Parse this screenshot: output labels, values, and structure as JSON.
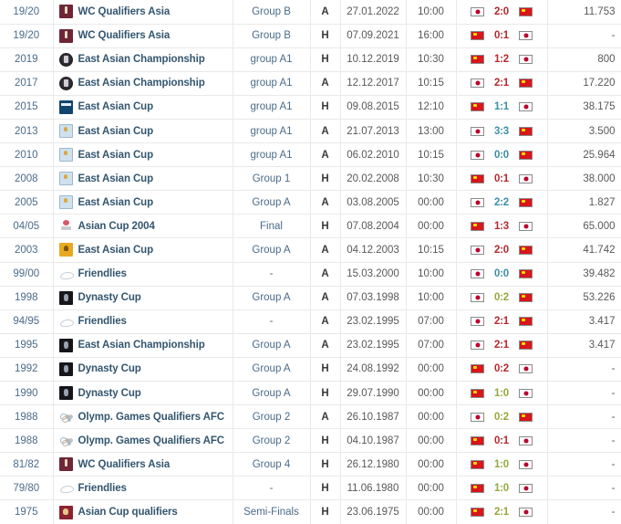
{
  "table": {
    "name": "match-history-table",
    "colors": {
      "link": "#33566f",
      "season": "#4a6b8a",
      "score_loss": "#b4292f",
      "score_win": "#93a93d",
      "score_draw": "#3a8fa3",
      "row_border": "#e9e9ea"
    },
    "rows": [
      {
        "season": "19/20",
        "logo": "wc-qualifiers-asia-logo",
        "competition": "WC Qualifiers Asia",
        "round": "Group B",
        "venue": "A",
        "date": "27.01.2022",
        "time": "10:00",
        "home_flag": "japan-flag",
        "score": "2:0",
        "score_type": "loss",
        "away_flag": "china-flag",
        "attendance": "11.753"
      },
      {
        "season": "19/20",
        "logo": "wc-qualifiers-asia-logo",
        "competition": "WC Qualifiers Asia",
        "round": "Group B",
        "venue": "H",
        "date": "07.09.2021",
        "time": "16:00",
        "home_flag": "china-flag",
        "score": "0:1",
        "score_type": "loss",
        "away_flag": "japan-flag",
        "attendance": "-"
      },
      {
        "season": "2019",
        "logo": "east-asian-championship-logo",
        "competition": "East Asian Championship",
        "round": "group A1",
        "venue": "H",
        "date": "10.12.2019",
        "time": "10:30",
        "home_flag": "china-flag",
        "score": "1:2",
        "score_type": "loss",
        "away_flag": "japan-flag",
        "attendance": "800"
      },
      {
        "season": "2017",
        "logo": "east-asian-championship-logo",
        "competition": "East Asian Championship",
        "round": "group A1",
        "venue": "A",
        "date": "12.12.2017",
        "time": "10:15",
        "home_flag": "japan-flag",
        "score": "2:1",
        "score_type": "loss",
        "away_flag": "china-flag",
        "attendance": "17.220"
      },
      {
        "season": "2015",
        "logo": "east-asian-cup-blue-logo",
        "competition": "East Asian Cup",
        "round": "group A1",
        "venue": "H",
        "date": "09.08.2015",
        "time": "12:10",
        "home_flag": "china-flag",
        "score": "1:1",
        "score_type": "draw",
        "away_flag": "japan-flag",
        "attendance": "38.175"
      },
      {
        "season": "2013",
        "logo": "east-asian-cup-lightblue-logo",
        "competition": "East Asian Cup",
        "round": "group A1",
        "venue": "A",
        "date": "21.07.2013",
        "time": "13:00",
        "home_flag": "japan-flag",
        "score": "3:3",
        "score_type": "draw",
        "away_flag": "china-flag",
        "attendance": "3.500"
      },
      {
        "season": "2010",
        "logo": "east-asian-cup-lightblue-logo",
        "competition": "East Asian Cup",
        "round": "group A1",
        "venue": "A",
        "date": "06.02.2010",
        "time": "10:15",
        "home_flag": "japan-flag",
        "score": "0:0",
        "score_type": "draw",
        "away_flag": "china-flag",
        "attendance": "25.964"
      },
      {
        "season": "2008",
        "logo": "east-asian-cup-lightblue-logo",
        "competition": "East Asian Cup",
        "round": "Group 1",
        "venue": "H",
        "date": "20.02.2008",
        "time": "10:30",
        "home_flag": "china-flag",
        "score": "0:1",
        "score_type": "loss",
        "away_flag": "japan-flag",
        "attendance": "38.000"
      },
      {
        "season": "2005",
        "logo": "east-asian-cup-lightblue-logo",
        "competition": "East Asian Cup",
        "round": "Group A",
        "venue": "A",
        "date": "03.08.2005",
        "time": "00:00",
        "home_flag": "japan-flag",
        "score": "2:2",
        "score_type": "draw",
        "away_flag": "china-flag",
        "attendance": "1.827"
      },
      {
        "season": "04/05",
        "logo": "asian-cup-2004-logo",
        "competition": "Asian Cup 2004",
        "round": "Final",
        "venue": "H",
        "date": "07.08.2004",
        "time": "00:00",
        "home_flag": "china-flag",
        "score": "1:3",
        "score_type": "loss",
        "away_flag": "japan-flag",
        "attendance": "65.000"
      },
      {
        "season": "2003",
        "logo": "east-asian-cup-gold-logo",
        "competition": "East Asian Cup",
        "round": "Group A",
        "venue": "A",
        "date": "04.12.2003",
        "time": "10:15",
        "home_flag": "japan-flag",
        "score": "2:0",
        "score_type": "loss",
        "away_flag": "china-flag",
        "attendance": "41.742"
      },
      {
        "season": "99/00",
        "logo": "friendlies-logo",
        "competition": "Friendlies",
        "round": "-",
        "venue": "A",
        "date": "15.03.2000",
        "time": "10:00",
        "home_flag": "japan-flag",
        "score": "0:0",
        "score_type": "draw",
        "away_flag": "china-flag",
        "attendance": "39.482"
      },
      {
        "season": "1998",
        "logo": "dynasty-cup-logo",
        "competition": "Dynasty Cup",
        "round": "Group A",
        "venue": "A",
        "date": "07.03.1998",
        "time": "10:00",
        "home_flag": "japan-flag",
        "score": "0:2",
        "score_type": "win",
        "away_flag": "china-flag",
        "attendance": "53.226"
      },
      {
        "season": "94/95",
        "logo": "friendlies-logo",
        "competition": "Friendlies",
        "round": "-",
        "venue": "A",
        "date": "23.02.1995",
        "time": "07:00",
        "home_flag": "japan-flag",
        "score": "2:1",
        "score_type": "loss",
        "away_flag": "china-flag",
        "attendance": "3.417"
      },
      {
        "season": "1995",
        "logo": "dynasty-cup-logo",
        "competition": "East Asian Championship",
        "round": "Group A",
        "venue": "A",
        "date": "23.02.1995",
        "time": "07:00",
        "home_flag": "japan-flag",
        "score": "2:1",
        "score_type": "loss",
        "away_flag": "china-flag",
        "attendance": "3.417"
      },
      {
        "season": "1992",
        "logo": "dynasty-cup-logo",
        "competition": "Dynasty Cup",
        "round": "Group A",
        "venue": "H",
        "date": "24.08.1992",
        "time": "00:00",
        "home_flag": "china-flag",
        "score": "0:2",
        "score_type": "loss",
        "away_flag": "japan-flag",
        "attendance": "-"
      },
      {
        "season": "1990",
        "logo": "dynasty-cup-logo",
        "competition": "Dynasty Cup",
        "round": "Group A",
        "venue": "H",
        "date": "29.07.1990",
        "time": "00:00",
        "home_flag": "china-flag",
        "score": "1:0",
        "score_type": "win",
        "away_flag": "japan-flag",
        "attendance": "-"
      },
      {
        "season": "1988",
        "logo": "olympic-games-qualifiers-logo",
        "competition": "Olymp. Games Qualifiers AFC",
        "round": "Group 2",
        "venue": "A",
        "date": "26.10.1987",
        "time": "00:00",
        "home_flag": "japan-flag",
        "score": "0:2",
        "score_type": "win",
        "away_flag": "china-flag",
        "attendance": "-"
      },
      {
        "season": "1988",
        "logo": "olympic-games-qualifiers-logo",
        "competition": "Olymp. Games Qualifiers AFC",
        "round": "Group 2",
        "venue": "H",
        "date": "04.10.1987",
        "time": "00:00",
        "home_flag": "china-flag",
        "score": "0:1",
        "score_type": "loss",
        "away_flag": "japan-flag",
        "attendance": "-"
      },
      {
        "season": "81/82",
        "logo": "wc-qualifiers-asia-logo",
        "competition": "WC Qualifiers Asia",
        "round": "Group 4",
        "venue": "H",
        "date": "26.12.1980",
        "time": "00:00",
        "home_flag": "china-flag",
        "score": "1:0",
        "score_type": "win",
        "away_flag": "japan-flag",
        "attendance": "-"
      },
      {
        "season": "79/80",
        "logo": "friendlies-logo",
        "competition": "Friendlies",
        "round": "-",
        "venue": "H",
        "date": "11.06.1980",
        "time": "00:00",
        "home_flag": "china-flag",
        "score": "1:0",
        "score_type": "win",
        "away_flag": "japan-flag",
        "attendance": "-"
      },
      {
        "season": "1975",
        "logo": "asian-cup-qualifiers-logo",
        "competition": "Asian Cup qualifiers",
        "round": "Semi-Finals",
        "venue": "H",
        "date": "23.06.1975",
        "time": "00:00",
        "home_flag": "china-flag",
        "score": "2:1",
        "score_type": "win",
        "away_flag": "japan-flag",
        "attendance": "-"
      }
    ]
  }
}
